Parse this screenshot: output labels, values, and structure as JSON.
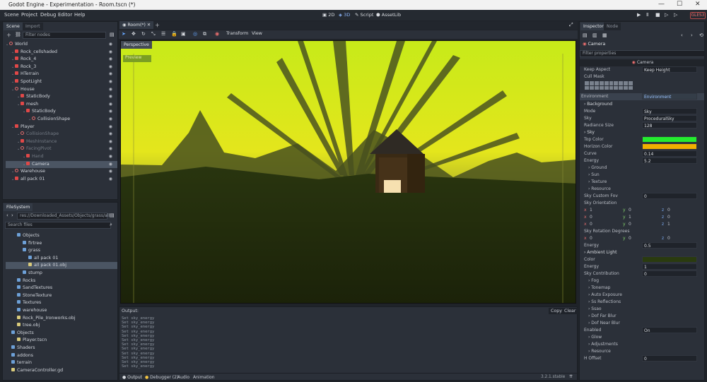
{
  "window": {
    "title": "Godot Engine - Experimentation - Room.tscn (*)"
  },
  "menu": [
    "Scene",
    "Project",
    "Debug",
    "Editor",
    "Help"
  ],
  "modes": [
    "2D",
    "3D",
    "Script",
    "AssetLib"
  ],
  "renderer": "GLES3",
  "left_dock": {
    "tabs": [
      "Scene",
      "Import"
    ],
    "filter_placeholder": "Filter nodes",
    "tree": [
      {
        "label": "World",
        "indent": 0,
        "type": "circle",
        "visible": true
      },
      {
        "label": "Rock_cellshaded",
        "indent": 1,
        "type": "node",
        "visible": true
      },
      {
        "label": "Rock_4",
        "indent": 1,
        "type": "node",
        "visible": true
      },
      {
        "label": "Rock_3",
        "indent": 1,
        "type": "node",
        "visible": true
      },
      {
        "label": "HTerrain",
        "indent": 1,
        "type": "node",
        "visible": true
      },
      {
        "label": "SpotLight",
        "indent": 1,
        "type": "node",
        "visible": true
      },
      {
        "label": "House",
        "indent": 1,
        "type": "circle",
        "visible": true
      },
      {
        "label": "StaticBody",
        "indent": 2,
        "type": "node",
        "visible": true
      },
      {
        "label": "mesh",
        "indent": 2,
        "type": "node",
        "visible": true
      },
      {
        "label": "StaticBody",
        "indent": 3,
        "type": "node",
        "visible": true
      },
      {
        "label": "CollisionShape",
        "indent": 4,
        "type": "circle",
        "visible": true
      },
      {
        "label": "Player",
        "indent": 1,
        "type": "node",
        "visible": true
      },
      {
        "label": "CollisionShape",
        "indent": 2,
        "type": "circle",
        "visible": true,
        "dim": true
      },
      {
        "label": "MeshInstance",
        "indent": 2,
        "type": "node",
        "visible": true,
        "dim": true
      },
      {
        "label": "FacingPivot",
        "indent": 2,
        "type": "circle",
        "visible": true,
        "dim": true
      },
      {
        "label": "Hand",
        "indent": 3,
        "type": "node",
        "visible": true,
        "dim": true
      },
      {
        "label": "Camera",
        "indent": 3,
        "type": "node",
        "visible": true,
        "selected": true
      },
      {
        "label": "Warehouse",
        "indent": 1,
        "type": "circle",
        "visible": true
      },
      {
        "label": "all pack 01",
        "indent": 1,
        "type": "node",
        "visible": true
      }
    ]
  },
  "filesystem": {
    "tab": "FileSystem",
    "path": "res://Downloaded_Assets/Objects/grass/all",
    "search_placeholder": "Search files",
    "items": [
      {
        "label": "Objects",
        "indent": 1,
        "type": "folder"
      },
      {
        "label": "firtree",
        "indent": 2,
        "type": "folder"
      },
      {
        "label": "grass",
        "indent": 2,
        "type": "folder"
      },
      {
        "label": "all pack 01",
        "indent": 3,
        "type": "folder"
      },
      {
        "label": "all pack 01.obj",
        "indent": 3,
        "type": "file",
        "selected": true
      },
      {
        "label": "stump",
        "indent": 2,
        "type": "folder"
      },
      {
        "label": "Rocks",
        "indent": 1,
        "type": "folder"
      },
      {
        "label": "SandTextures",
        "indent": 1,
        "type": "folder"
      },
      {
        "label": "StoneTexture",
        "indent": 1,
        "type": "folder"
      },
      {
        "label": "Textures",
        "indent": 1,
        "type": "folder"
      },
      {
        "label": "warehouse",
        "indent": 1,
        "type": "folder"
      },
      {
        "label": "Rock_Pile_Ironworks.obj",
        "indent": 1,
        "type": "file"
      },
      {
        "label": "tree.obj",
        "indent": 1,
        "type": "file"
      },
      {
        "label": "Objects",
        "indent": 0,
        "type": "folder"
      },
      {
        "label": "Player.tscn",
        "indent": 1,
        "type": "file"
      },
      {
        "label": "Shaders",
        "indent": 0,
        "type": "folder"
      },
      {
        "label": "addons",
        "indent": 0,
        "type": "folder"
      },
      {
        "label": "terrain",
        "indent": 0,
        "type": "folder"
      },
      {
        "label": "CameraController.gd",
        "indent": 0,
        "type": "file"
      }
    ]
  },
  "editor": {
    "scene_tab": "Room(*)",
    "toolbar": {
      "transform": "Transform",
      "view": "View"
    },
    "viewport": {
      "label": "Perspective",
      "preview": "Preview"
    }
  },
  "output": {
    "label": "Output:",
    "copy": "Copy",
    "clear": "Clear",
    "lines": [
      "Set sky_energy",
      "Set sky_energy",
      "Set sky_energy",
      "Set sky_energy",
      "Set sky_energy",
      "Set sky_energy",
      "Set sky_energy",
      "Set sky_energy",
      "Set sky_energy",
      "Set sky_energy",
      "Set sky_energy",
      "Set sky_energy"
    ],
    "bottom_tabs": [
      "Output",
      "Debugger (2)",
      "Audio",
      "Animation"
    ],
    "version": "3.2.1.stable"
  },
  "inspector": {
    "tabs": [
      "Inspector",
      "Node"
    ],
    "object": "Camera",
    "filter_placeholder": "Filter properties",
    "class_label": "Camera",
    "keep_aspect": {
      "label": "Keep Aspect",
      "value": "Keep Height"
    },
    "cull_mask": "Cull Mask",
    "environment": {
      "label": "Environment",
      "value": "Environment"
    },
    "rows": [
      {
        "label": "Background",
        "type": "section"
      },
      {
        "label": "Mode",
        "value": "Sky"
      },
      {
        "label": "Sky",
        "value": "ProceduralSky"
      },
      {
        "label": "Radiance Size",
        "value": "128"
      },
      {
        "label": "Sky",
        "type": "section"
      },
      {
        "label": "Top Color",
        "color": "#24ec2f"
      },
      {
        "label": "Horizon Color",
        "color": "#f0b000"
      },
      {
        "label": "Curve",
        "value": "0.14"
      },
      {
        "label": "Energy",
        "value": "5.2"
      },
      {
        "label": "Ground",
        "type": "sub"
      },
      {
        "label": "Sun",
        "type": "sub"
      },
      {
        "label": "Texture",
        "type": "sub"
      },
      {
        "label": "Resource",
        "type": "sub"
      },
      {
        "label": "Sky Custom Fov",
        "value": "0"
      },
      {
        "label": "Sky Orientation",
        "type": "label"
      },
      {
        "label": "Sky Rotation Degrees",
        "type": "label"
      },
      {
        "label": "Energy",
        "value": "0.5"
      },
      {
        "label": "Ambient Light",
        "type": "section"
      },
      {
        "label": "Color",
        "color": "#2a3b0f"
      },
      {
        "label": "Energy",
        "value": "1"
      },
      {
        "label": "Sky Contribution",
        "value": "0"
      },
      {
        "label": "Fog",
        "type": "sub"
      },
      {
        "label": "Tonemap",
        "type": "sub"
      },
      {
        "label": "Auto Exposure",
        "type": "sub"
      },
      {
        "label": "Ss Reflections",
        "type": "sub"
      },
      {
        "label": "Ssao",
        "type": "sub"
      },
      {
        "label": "Dof Far Blur",
        "type": "sub"
      },
      {
        "label": "Dof Near Blur",
        "type": "sub"
      },
      {
        "label": "Enabled",
        "value": "On"
      },
      {
        "label": "Glow",
        "type": "sub"
      },
      {
        "label": "Adjustments",
        "type": "sub"
      },
      {
        "label": "Resource",
        "type": "sub"
      },
      {
        "label": "H Offset",
        "value": "0"
      }
    ],
    "orientation": [
      [
        "x",
        "1",
        "y",
        "0",
        "z",
        "0"
      ],
      [
        "x",
        "0",
        "y",
        "1",
        "z",
        "0"
      ],
      [
        "x",
        "0",
        "y",
        "0",
        "z",
        "1"
      ]
    ],
    "rotation": [
      "x",
      "0",
      "y",
      "0",
      "z",
      "0"
    ]
  }
}
